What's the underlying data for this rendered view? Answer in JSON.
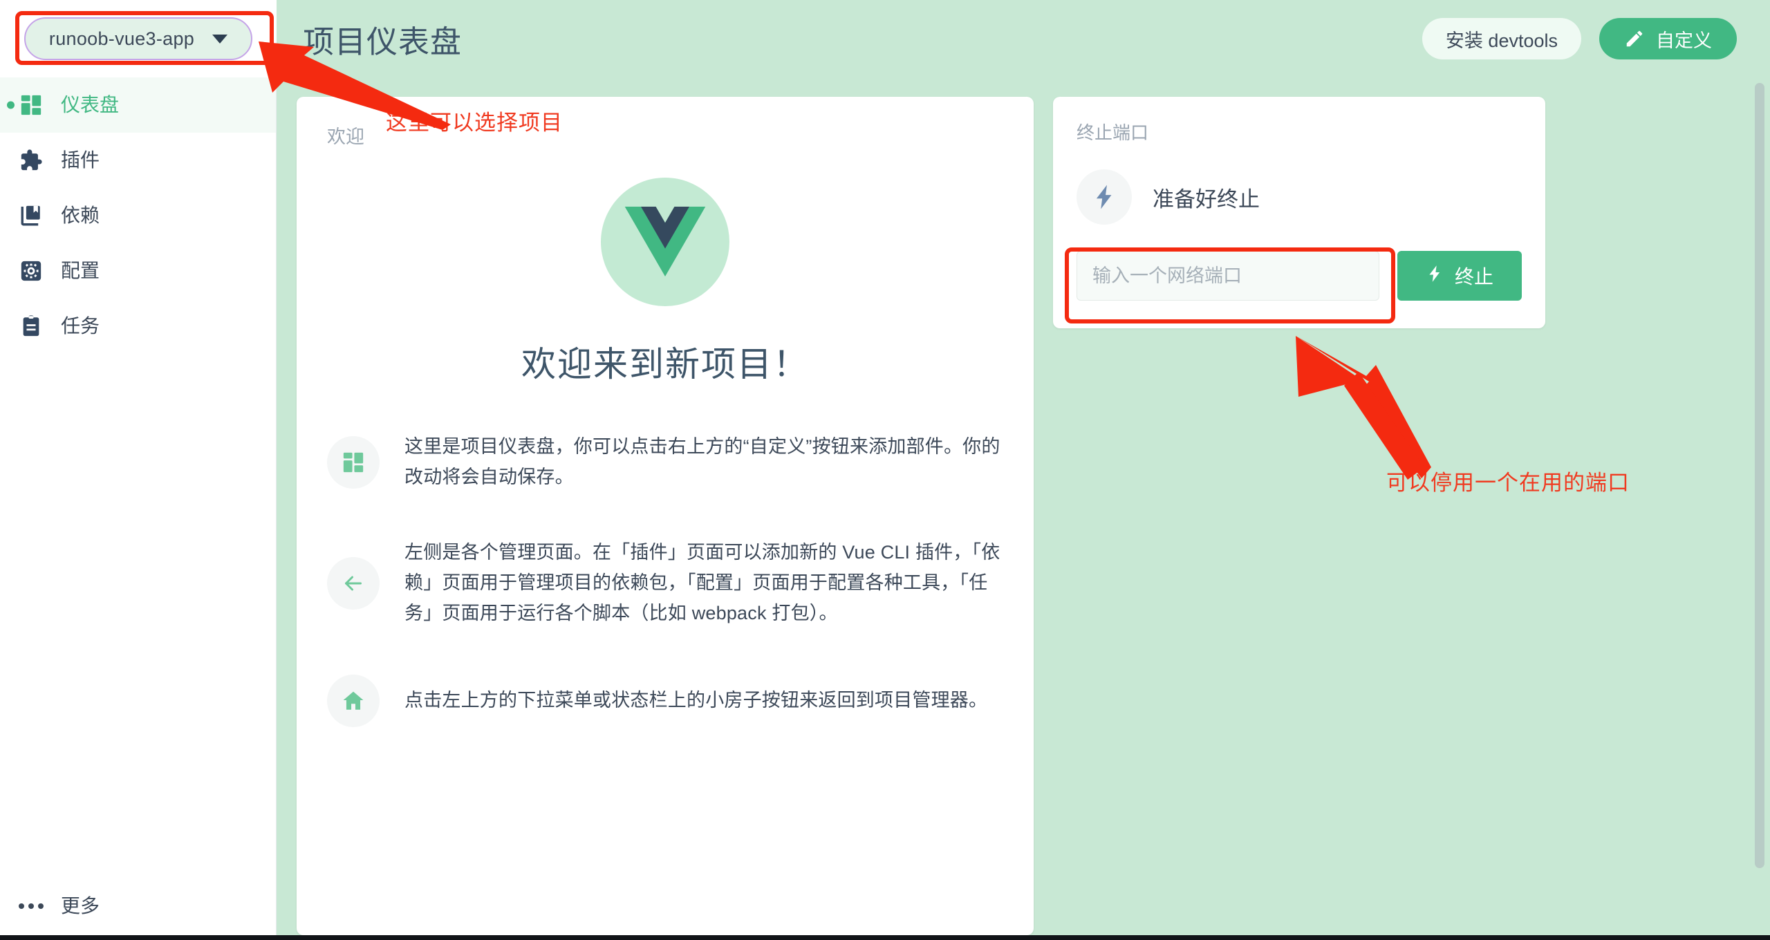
{
  "app": {
    "accent_green": "#41b883",
    "header_bg": "#c8e8d4",
    "annotation_red": "#f03a20",
    "project_pill_border": "#c5a4e8"
  },
  "topbar": {
    "project_name": "runoob-vue3-app",
    "caret_icon": "chevron-down-icon",
    "title": "项目仪表盘",
    "devtools_button": "安装 devtools",
    "customize_button": "自定义",
    "customize_icon": "pencil-icon"
  },
  "sidebar": {
    "items": [
      {
        "label": "仪表盘",
        "icon": "dashboard-icon",
        "active": true
      },
      {
        "label": "插件",
        "icon": "puzzle-icon",
        "active": false
      },
      {
        "label": "依赖",
        "icon": "book-icon",
        "active": false
      },
      {
        "label": "配置",
        "icon": "gear-icon",
        "active": false
      },
      {
        "label": "任务",
        "icon": "clipboard-icon",
        "active": false
      }
    ],
    "more": {
      "label": "更多",
      "icon": "ellipsis-icon"
    }
  },
  "welcome": {
    "label": "欢迎",
    "logo_icon": "vue-logo-icon",
    "heading": "欢迎来到新项目！",
    "features": [
      {
        "icon": "dashboard-icon",
        "text": "这里是项目仪表盘，你可以点击右上方的“自定义”按钮来添加部件。你的改动将会自动保存。"
      },
      {
        "icon": "arrow-left-icon",
        "text": "左侧是各个管理页面。在「插件」页面可以添加新的 Vue CLI 插件，「依赖」页面用于管理项目的依赖包，「配置」页面用于配置各种工具，「任务」页面用于运行各个脚本（比如 webpack 打包）。"
      },
      {
        "icon": "home-icon",
        "text": "点击左上方的下拉菜单或状态栏上的小房子按钮来返回到项目管理器。"
      }
    ]
  },
  "terminate": {
    "title": "终止端口",
    "status_icon": "bolt-icon",
    "status_text": "准备好终止",
    "input_placeholder": "输入一个网络端口",
    "input_value": "",
    "button_label": "终止",
    "button_icon": "bolt-icon"
  },
  "annotations": {
    "select_project": "这里可以选择项目",
    "stop_port": "可以停用一个在用的端口",
    "arrow_to_project": "arrow-icon",
    "arrow_to_port": "arrow-icon"
  }
}
